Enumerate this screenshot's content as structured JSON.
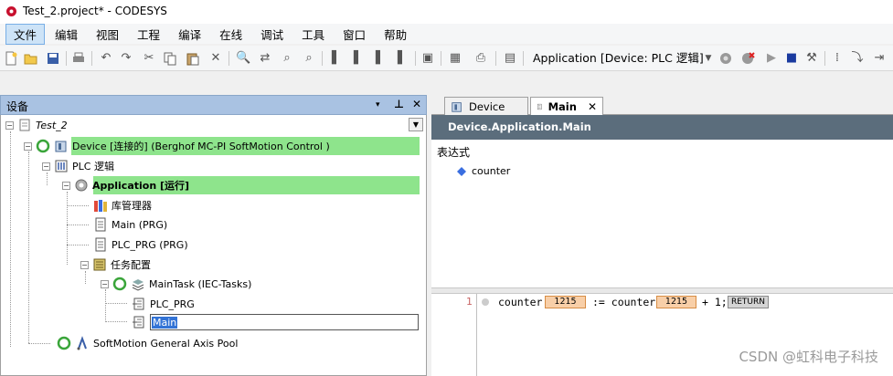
{
  "window": {
    "title": "Test_2.project* - CODESYS"
  },
  "menu": {
    "items": [
      "文件",
      "编辑",
      "视图",
      "工程",
      "编译",
      "在线",
      "调试",
      "工具",
      "窗口",
      "帮助"
    ],
    "active": "文件"
  },
  "toolbar": {
    "application_select": "Application [Device: PLC 逻辑]"
  },
  "devices_panel": {
    "title": "设备",
    "controls": [
      "▾",
      "⊥",
      "✕"
    ],
    "tree": {
      "project": "Test_2",
      "device": "Device [连接的] (Berghof MC-PI SoftMotion Control )",
      "plc_logic": "PLC 逻辑",
      "application": "Application [运行]",
      "library_manager": "库管理器",
      "main_prg": "Main (PRG)",
      "plc_prg": "PLC_PRG (PRG)",
      "task_config": "任务配置",
      "main_task": "MainTask (IEC-Tasks)",
      "task_plc_prg": "PLC_PRG",
      "task_main": "Main",
      "axis_pool": "SoftMotion General Axis Pool"
    }
  },
  "editor": {
    "tabs": [
      {
        "label": "Device"
      },
      {
        "label": "Main",
        "active": true
      }
    ],
    "path": "Device.Application.Main",
    "watch_header": "表达式",
    "watch_item": "counter",
    "code": {
      "line_number": "1",
      "tok_var1": "counter",
      "val1": "1215",
      "tok_assign": ":= counter",
      "val2": "1215",
      "tok_plus": "+ 1;",
      "ret": "RETURN"
    }
  },
  "watermark": "CSDN @虹科电子科技",
  "colors": {
    "accent_green": "#8ee48c",
    "path_bar": "#5b6d7c",
    "value_box": "#f8cfa8"
  }
}
